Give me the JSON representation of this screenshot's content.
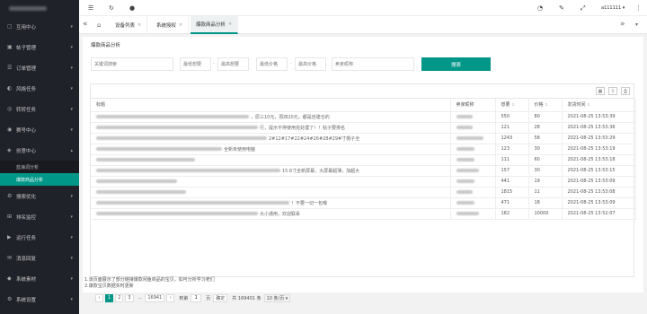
{
  "sidebar": {
    "items": [
      {
        "label": "互用中心",
        "icon": "▢",
        "expanded": false
      },
      {
        "label": "帖子管理",
        "icon": "▣",
        "expanded": false
      },
      {
        "label": "订单管理",
        "icon": "☰",
        "expanded": false
      },
      {
        "label": "风格任务",
        "icon": "◐",
        "expanded": false
      },
      {
        "label": "转转任务",
        "icon": "◎",
        "expanded": false
      },
      {
        "label": "赛号中心",
        "icon": "◉",
        "expanded": false
      },
      {
        "label": "创意中心",
        "icon": "◈",
        "expanded": true
      }
    ],
    "subitems": [
      {
        "label": "蓝海词分析",
        "active": false
      },
      {
        "label": "爆款商品分析",
        "active": true
      }
    ],
    "items2": [
      {
        "label": "搜索优化",
        "icon": "⚙"
      },
      {
        "label": "排名监控",
        "icon": "⊞"
      },
      {
        "label": "运行任务",
        "icon": "▶"
      },
      {
        "label": "消息回复",
        "icon": "✉"
      },
      {
        "label": "系统素材",
        "icon": "◆"
      },
      {
        "label": "系统设置",
        "icon": "⚙"
      }
    ]
  },
  "topbar": {
    "user": "a111111 ▾"
  },
  "tabs": [
    {
      "label": "设备列表",
      "active": false
    },
    {
      "label": "系统授权",
      "active": false
    },
    {
      "label": "爆款商品分析",
      "active": true
    }
  ],
  "page": {
    "title": "爆款商品分析"
  },
  "filters": {
    "keyword_placeholder": "关键词搜索",
    "want_min_placeholder": "最低想要",
    "want_max_placeholder": "最高想要",
    "price_min_placeholder": "最低价格",
    "price_max_placeholder": "最高价格",
    "extra_placeholder": "卖家昵称",
    "search_label": "搜索"
  },
  "table": {
    "columns": [
      "标题",
      "卖家昵称",
      "想要",
      "价格",
      "发货时间"
    ],
    "rows": [
      {
        "title_tail": "，原三10元，原四20元，都是自建仓的",
        "want": "550",
        "price": "80",
        "time": "2021-08-25 13:53:39"
      },
      {
        "title_tail": "行，提示不停使用完处理了！！帖子要排名",
        "want": "121",
        "price": "28",
        "time": "2021-08-25 13:53:36"
      },
      {
        "title_tail": "2#12#17#22#24#26#28#29#寸帽子全",
        "want": "1243",
        "price": "58",
        "time": "2021-08-25 13:53:29"
      },
      {
        "title_tail": "全新未使用电脑",
        "want": "123",
        "price": "30",
        "time": "2021-08-25 13:53:19"
      },
      {
        "title_tail": "",
        "want": "111",
        "price": "60",
        "time": "2021-08-25 13:53:18"
      },
      {
        "title_tail": "15.6寸全新屏幕，大屏幕超薄，加超大",
        "want": "157",
        "price": "30",
        "time": "2021-08-25 13:53:15"
      },
      {
        "title_tail": "",
        "want": "441",
        "price": "19",
        "time": "2021-08-25 13:53:09"
      },
      {
        "title_tail": "",
        "want": "1815",
        "price": "11",
        "time": "2021-08-25 13:53:08"
      },
      {
        "title_tail": "！不要一切一包哦",
        "want": "471",
        "price": "18",
        "time": "2021-08-25 13:53:09"
      },
      {
        "title_tail": "大小通用，欢迎联系",
        "want": "182",
        "price": "10000",
        "time": "2021-08-25 13:52:07"
      }
    ]
  },
  "pager": {
    "prev": "‹",
    "pages": [
      "1",
      "2",
      "3"
    ],
    "ellipsis": "...",
    "last": "16941",
    "next": "›",
    "goto_label": "到第",
    "goto_value": "1",
    "page_unit": "页",
    "confirm": "确定",
    "total": "共 169401 条",
    "per_page": "10 条/页 ▾"
  },
  "notes": [
    "1.该页面展示了部分链接爆款闲鱼商品的宝贝，如可分析学习老们",
    "2.爆款宝贝数据实时更新"
  ]
}
